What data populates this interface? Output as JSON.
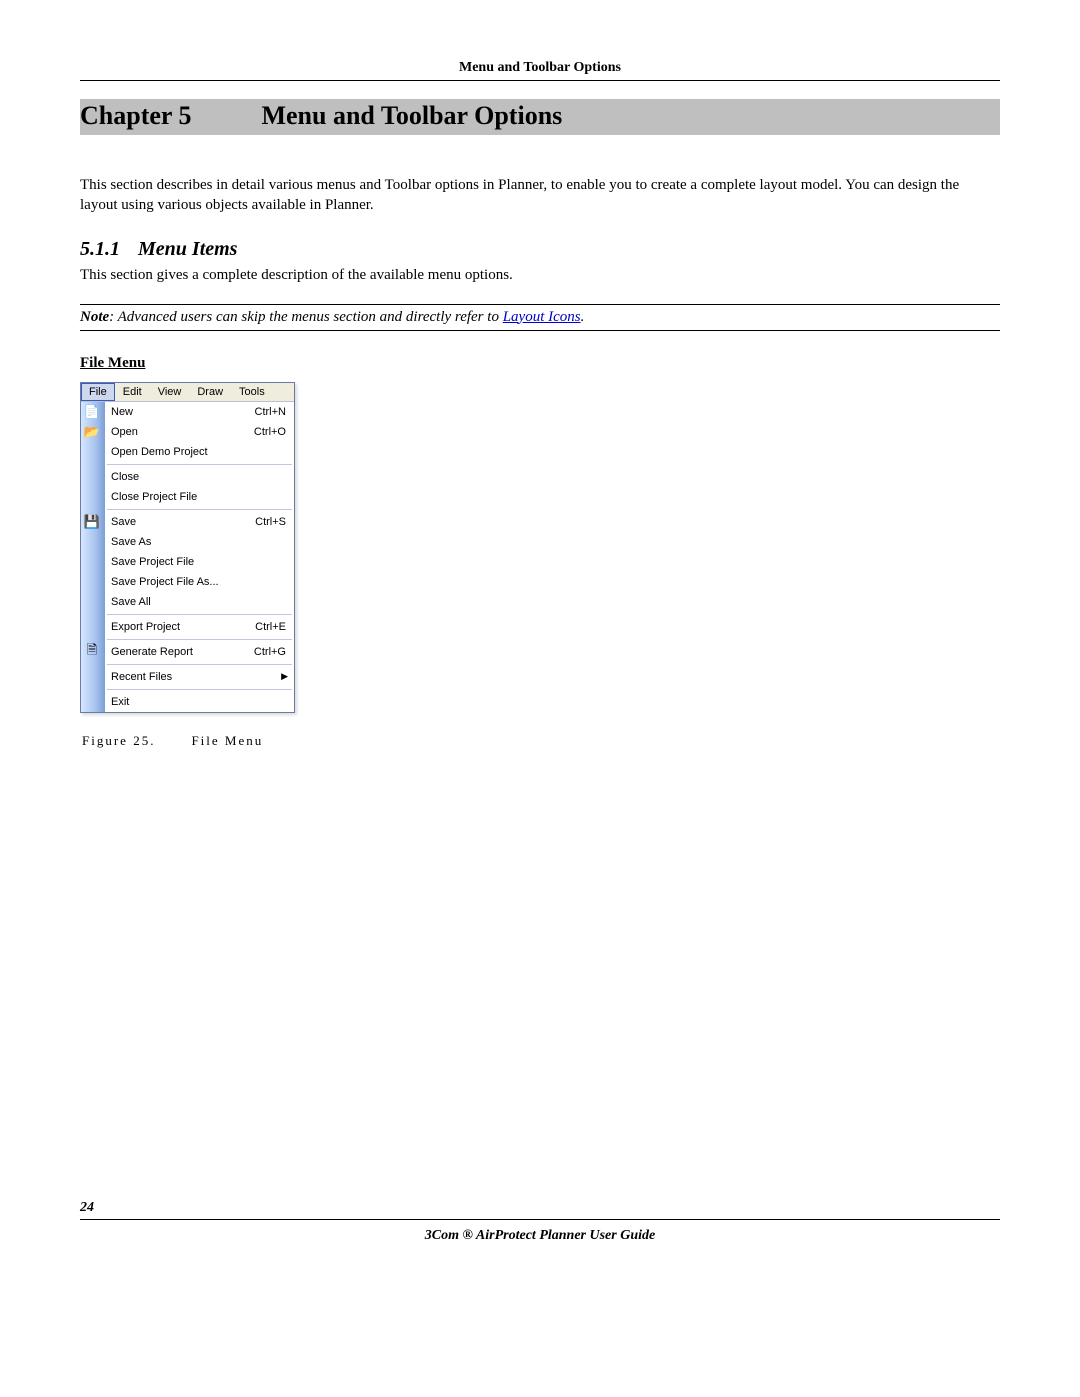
{
  "header_title": "Menu and Toolbar Options",
  "chapter_label": "Chapter 5",
  "chapter_title": "Menu and Toolbar Options",
  "intro_para": "This section describes in detail various menus and Toolbar options in Planner, to enable you to create a complete layout model. You can design the layout using various objects available in Planner.",
  "section": {
    "num": "5.1.1",
    "title": "Menu Items"
  },
  "section_body": "This section gives a complete description of the available menu options.",
  "note": {
    "label": "Note",
    "text_prefix": ": Advanced users can skip the menus section and directly refer to ",
    "link": "Layout Icons",
    "text_suffix": "."
  },
  "file_menu_heading": "File Menu",
  "menubar": [
    "File",
    "Edit",
    "View",
    "Draw",
    "Tools"
  ],
  "menu_items": [
    {
      "label": "New",
      "shortcut": "Ctrl+N",
      "icon": "new"
    },
    {
      "label": "Open",
      "shortcut": "Ctrl+O",
      "icon": "open"
    },
    {
      "label": "Open Demo Project"
    },
    {
      "sep": true
    },
    {
      "label": "Close"
    },
    {
      "label": "Close Project File"
    },
    {
      "sep": true
    },
    {
      "label": "Save",
      "shortcut": "Ctrl+S",
      "icon": "save"
    },
    {
      "label": "Save As"
    },
    {
      "label": "Save Project File"
    },
    {
      "label": "Save Project File As..."
    },
    {
      "label": "Save All"
    },
    {
      "sep": true
    },
    {
      "label": "Export Project",
      "shortcut": "Ctrl+E"
    },
    {
      "sep": true
    },
    {
      "label": "Generate Report",
      "shortcut": "Ctrl+G",
      "icon": "report"
    },
    {
      "sep": true
    },
    {
      "label": "Recent Files",
      "submenu": true
    },
    {
      "sep": true
    },
    {
      "label": "Exit"
    }
  ],
  "figure": {
    "label": "Figure 25.",
    "caption": "File Menu"
  },
  "page_number": "24",
  "footer": "3Com ® AirProtect Planner User Guide"
}
